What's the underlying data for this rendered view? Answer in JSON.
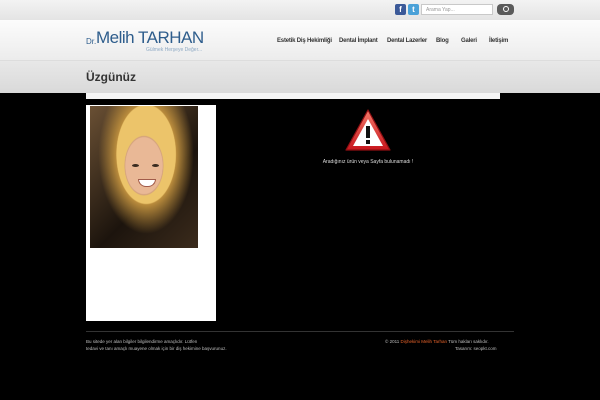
{
  "topbar": {
    "facebook_label": "f",
    "twitter_label": "t",
    "search_placeholder": "Arama Yap..."
  },
  "logo": {
    "dr": "Dr.",
    "name": "Melih TARHAN",
    "tagline": "Gülmek Herşeye Değer..."
  },
  "nav": {
    "items": [
      "Estetik Diş Hekimliği",
      "Dental İmplant",
      "Dental Lazerler",
      "Blog",
      "Galeri",
      "İletişim"
    ]
  },
  "page": {
    "title": "Üzgünüz",
    "error_message": "Aradığınız ürün veya Sayfa bulunamadı !"
  },
  "footer": {
    "left_line1": "Bu sitede yer alan bilgiler bilgilendirme amaçlıdır. Lütfen",
    "left_line2": "tedavi ve tanı amaçlı muayene olmak için bir diş hekimine başvurunuz.",
    "right_prefix": "© 2011",
    "right_name": "Dişhekimi Melih Tarhan",
    "right_suffix": "Tüm hakları saklıdır.",
    "right_line2": "Tasarım: seopkt.com"
  }
}
